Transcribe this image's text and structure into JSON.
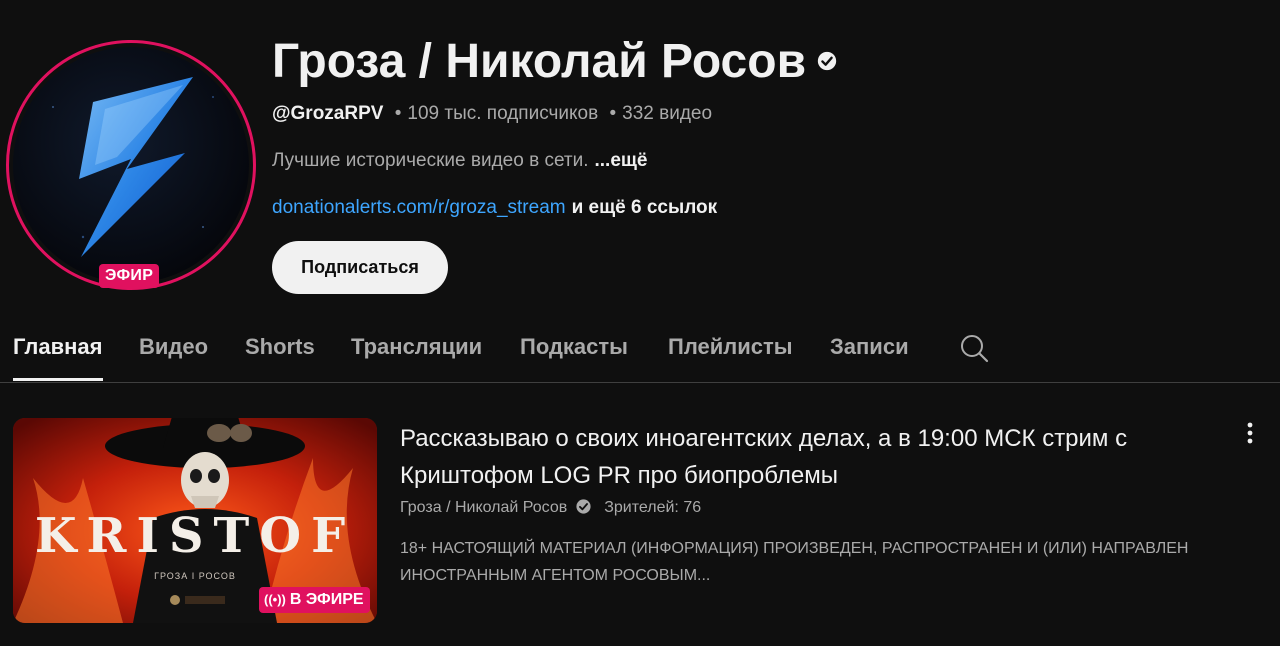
{
  "channel": {
    "title": "Гроза / Николай Росов",
    "live_badge": "ЭФИР",
    "handle": "@GrozaRPV",
    "separator": "•",
    "subscribers": "109 тыс. подписчиков",
    "videos": "332 видео",
    "description": "Лучшие исторические видео в сети.",
    "description_more": "...ещё",
    "link": "donationalerts.com/r/groza_stream",
    "more_links": "и ещё 6 ссылок",
    "subscribe_label": "Подписаться"
  },
  "tabs": [
    {
      "label": "Главная",
      "active": true
    },
    {
      "label": "Видео"
    },
    {
      "label": "Shorts"
    },
    {
      "label": "Трансляции"
    },
    {
      "label": "Подкасты"
    },
    {
      "label": "Плейлисты"
    },
    {
      "label": "Записи"
    }
  ],
  "featured": {
    "thumbnail_text": "KRISTOF",
    "thumbnail_subtext": "ГРОЗА І РОСОВ",
    "live_label": "В ЭФИРЕ",
    "title": "Рассказываю о своих иноагентских делах, а в 19:00 МСК стрим с Криштофом LOG PR про биопроблемы",
    "channel_name": "Гроза / Николай Росов",
    "viewers": "Зрителей: 76",
    "description": "18+ НАСТОЯЩИЙ МАТЕРИАЛ (ИНФОРМАЦИЯ) ПРОИЗВЕДЕН, РАСПРОСТРАНЕН И (ИЛИ) НАПРАВЛЕН ИНОСТРАННЫМ АГЕНТОМ РОСОВЫМ..."
  },
  "icons": {
    "verified": "verified-check-icon",
    "search": "search-icon",
    "more": "more-vert-icon",
    "live": "live-broadcast-icon"
  },
  "colors": {
    "background": "#0f0f0f",
    "live_red": "#e0115f",
    "link_blue": "#3ea6ff",
    "muted_text": "#aaaaaa"
  }
}
